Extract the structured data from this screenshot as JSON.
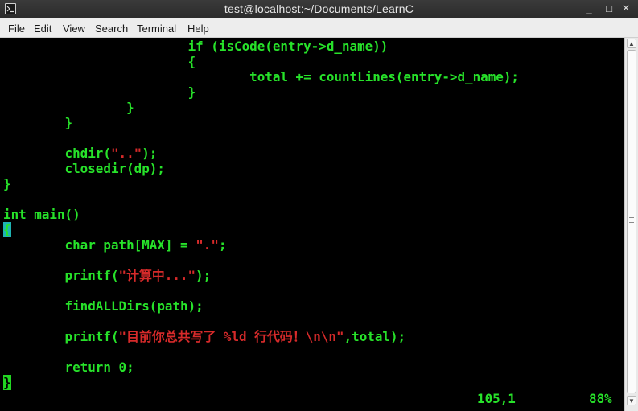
{
  "window": {
    "title": "test@localhost:~/Documents/LearnC",
    "minimize_glyph": "_",
    "maximize_glyph": "□",
    "close_glyph": "×",
    "icon": "terminal-icon"
  },
  "menubar": {
    "items": [
      "File",
      "Edit",
      "View",
      "Search",
      "Terminal",
      "Help"
    ]
  },
  "colors": {
    "code_text": "#27e22a",
    "string_literal": "#d62a2a",
    "background": "#000000",
    "cursor": "#22d622"
  },
  "editor": {
    "lines": [
      {
        "text": "                        if (isCode(entry->d_name))"
      },
      {
        "text": "                        {"
      },
      {
        "text": "                                total += countLines(entry->d_name);"
      },
      {
        "text": "                        }"
      },
      {
        "text": "                }"
      },
      {
        "text": "        }"
      },
      {
        "text": ""
      },
      {
        "pre": "        chdir(",
        "str": "\"..\"",
        "post": ");"
      },
      {
        "text": "        closedir(dp);"
      },
      {
        "text": "}"
      },
      {
        "text": ""
      },
      {
        "text": "int main()"
      },
      {
        "cursor_char": "{"
      },
      {
        "text": ""
      },
      {
        "pre": "        char path[MAX] = ",
        "str": "\".\"",
        "post": ";"
      },
      {
        "text": ""
      },
      {
        "pre": "        printf(",
        "str": "\"计算中...\"",
        "post": ");"
      },
      {
        "text": ""
      },
      {
        "text": "        findALLDirs(path);"
      },
      {
        "text": ""
      },
      {
        "pre": "        printf(",
        "str": "\"目前你总共写了 %ld 行代码！\\n\\n\"",
        "post": ",total);"
      },
      {
        "text": ""
      },
      {
        "text": "        return 0;"
      },
      {
        "cursor_char2": "}"
      }
    ],
    "status": {
      "position": "105,1",
      "percent": "88%"
    }
  }
}
